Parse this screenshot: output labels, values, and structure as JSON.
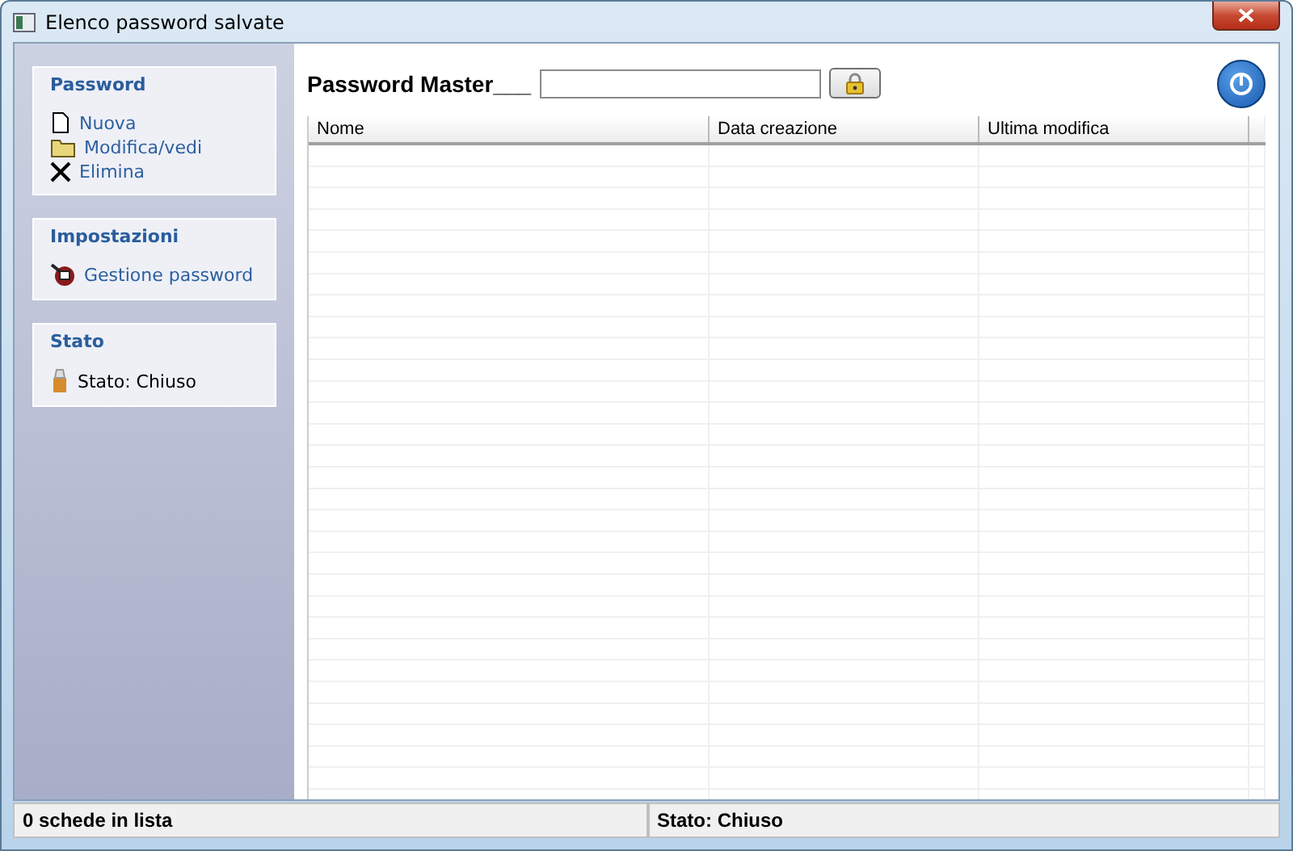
{
  "window": {
    "title": "Elenco password salvate"
  },
  "sidebar": {
    "sections": [
      {
        "title": "Password",
        "items": [
          {
            "label": "Nuova",
            "kind": "new"
          },
          {
            "label": "Modifica/vedi",
            "kind": "folder"
          },
          {
            "label": "Elimina",
            "kind": "delete"
          }
        ]
      },
      {
        "title": "Impostazioni",
        "items": [
          {
            "label": "Gestione password",
            "kind": "settings"
          }
        ]
      },
      {
        "title": "Stato",
        "items": [
          {
            "label": "Stato: Chiuso",
            "kind": "status"
          }
        ]
      }
    ]
  },
  "master": {
    "label": "Password Master___"
  },
  "table": {
    "columns": [
      "Nome",
      "Data creazione",
      "Ultima modifica"
    ]
  },
  "status_bar": [
    "0 schede in lista",
    "Stato: Chiuso"
  ]
}
